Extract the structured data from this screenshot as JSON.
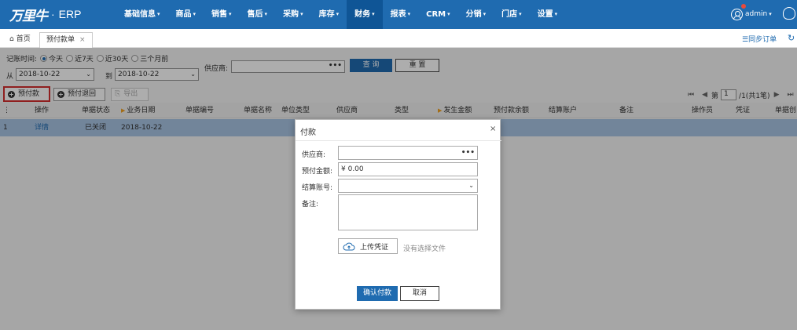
{
  "app": {
    "logo_mark": "万里牛",
    "logo_sep": "·",
    "logo_text": "ERP"
  },
  "nav": [
    "基础信息",
    "商品",
    "销售",
    "售后",
    "采购",
    "库存",
    "财务",
    "报表",
    "CRM",
    "分销",
    "门店",
    "设置"
  ],
  "user": {
    "name": "admin"
  },
  "tabs": {
    "home": "首页",
    "current": "预付款单"
  },
  "sync_label": "同步订单",
  "filters": {
    "period_label": "记账时间:",
    "period_options": [
      "今天",
      "近7天",
      "近30天",
      "三个月前"
    ],
    "from_label": "从",
    "from_value": "2018-10-22",
    "to_label": "到",
    "to_value": "2018-10-22",
    "supplier_label": "供应商:",
    "query_label": "查 询",
    "reset_label": "重 置"
  },
  "toolbar": {
    "prepay_label": "预付款",
    "refund_label": "预付退回",
    "export_label": "导出"
  },
  "pager": {
    "page_prefix": "第",
    "page_value": "1",
    "page_suffix": "/1(共1笔)"
  },
  "grid": {
    "columns": [
      "操作",
      "单据状态",
      "业务日期",
      "单据编号",
      "单据名称",
      "单位类型",
      "供应商",
      "类型",
      "发生金额",
      "预付款余额",
      "结算账户",
      "备注",
      "操作员",
      "凭证",
      "单据创"
    ],
    "rows": [
      {
        "index": "1",
        "action": "详情",
        "status": "已关闭",
        "date": "2018-10-22"
      }
    ]
  },
  "modal": {
    "title": "付款",
    "close": "×",
    "supplier_label": "供应商:",
    "amount_label": "预付金额:",
    "amount_value": "¥ 0.00",
    "account_label": "结算账号:",
    "note_label": "备注:",
    "upload_label": "上传凭证",
    "no_file_text": "没有选择文件",
    "confirm_label": "确认付款",
    "cancel_label": "取消"
  },
  "colors": {
    "primary": "#1f6bb0",
    "nav_active": "#0f5596",
    "row_selected": "#a9c4e4",
    "highlight_border": "#d32f2f"
  },
  "icons": [
    "home-icon",
    "close-icon",
    "menu-icon",
    "refresh-icon",
    "user-icon",
    "headset-icon",
    "plus-circle-icon",
    "upload-cloud-icon",
    "first-page-icon",
    "prev-page-icon",
    "next-page-icon",
    "last-page-icon"
  ]
}
